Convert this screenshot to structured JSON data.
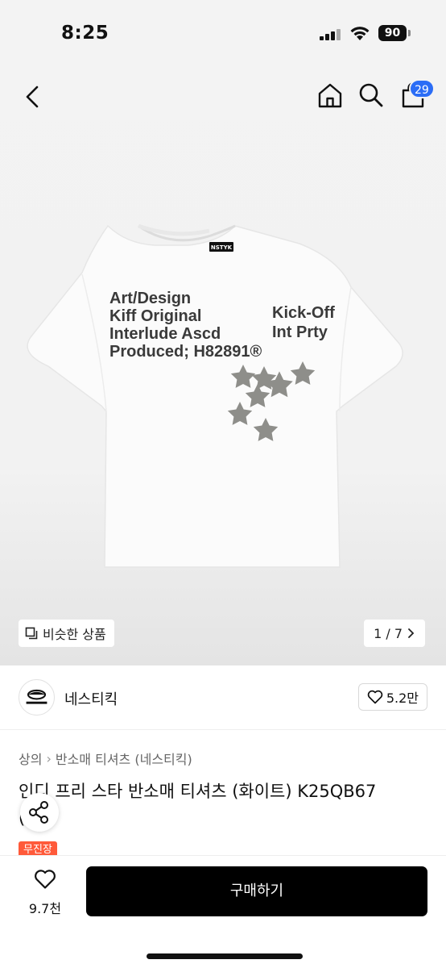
{
  "status_bar": {
    "time": "8:25",
    "battery": "90"
  },
  "nav": {
    "cart_count": "29"
  },
  "gallery": {
    "similar_label": "비슷한 상품",
    "page_indicator": "1 / 7",
    "shirt_print": {
      "left_lines": [
        "Art/Design",
        "Kiff Original",
        "Interlude Ascd",
        "Produced; H82891®"
      ],
      "right_lines": [
        "Kick-Off",
        "Int Prty"
      ],
      "neck_label": "NSTYK"
    }
  },
  "brand": {
    "name": "네스티킥",
    "likes": "5.2만"
  },
  "product": {
    "breadcrumb": [
      "상의",
      "반소매 티셔츠 (네스티킥)"
    ],
    "title": "인디 프리 스타 반소매 티셔츠 (화이트) K25QB67",
    "title_line2": "(",
    "tag": "무진장"
  },
  "bottom_bar": {
    "wish_count": "9.7천",
    "buy_label": "구매하기"
  },
  "colors": {
    "accent_badge": "#2b6df6",
    "buy_button": "#000000",
    "tag": "#ff5a3a",
    "star_print": "#8e8e8a"
  }
}
